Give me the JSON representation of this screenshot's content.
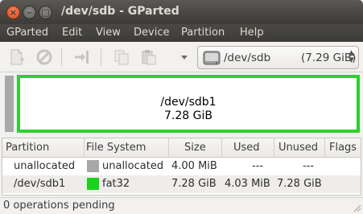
{
  "window": {
    "title": "/dev/sdb - GParted"
  },
  "menu": [
    "GParted",
    "Edit",
    "View",
    "Device",
    "Partition",
    "Help"
  ],
  "toolbar": {
    "device_name": "/dev/sdb",
    "device_size": "(7.29 GiB)",
    "icons": [
      "new-icon",
      "delete-icon",
      "resize-move-icon",
      "copy-icon",
      "paste-icon",
      "undo-dropdown-icon"
    ]
  },
  "map": {
    "partition_name": "/dev/sdb1",
    "partition_size": "7.28 GiB",
    "partition_color": "#2ed12e",
    "unallocated_color": "#a8a8a8"
  },
  "table": {
    "headers": [
      "Partition",
      "File System",
      "Size",
      "Used",
      "Unused",
      "Flags"
    ],
    "rows": [
      {
        "partition": "unallocated",
        "fs": "unallocated",
        "fs_color": "#a8a8a8",
        "size": "4.00 MiB",
        "used": "---",
        "unused": "---",
        "flags": ""
      },
      {
        "partition": "/dev/sdb1",
        "fs": "fat32",
        "fs_color": "#18d418",
        "size": "7.28 GiB",
        "used": "4.03 MiB",
        "unused": "7.28 GiB",
        "flags": ""
      }
    ]
  },
  "status": {
    "text": "0 operations pending"
  }
}
